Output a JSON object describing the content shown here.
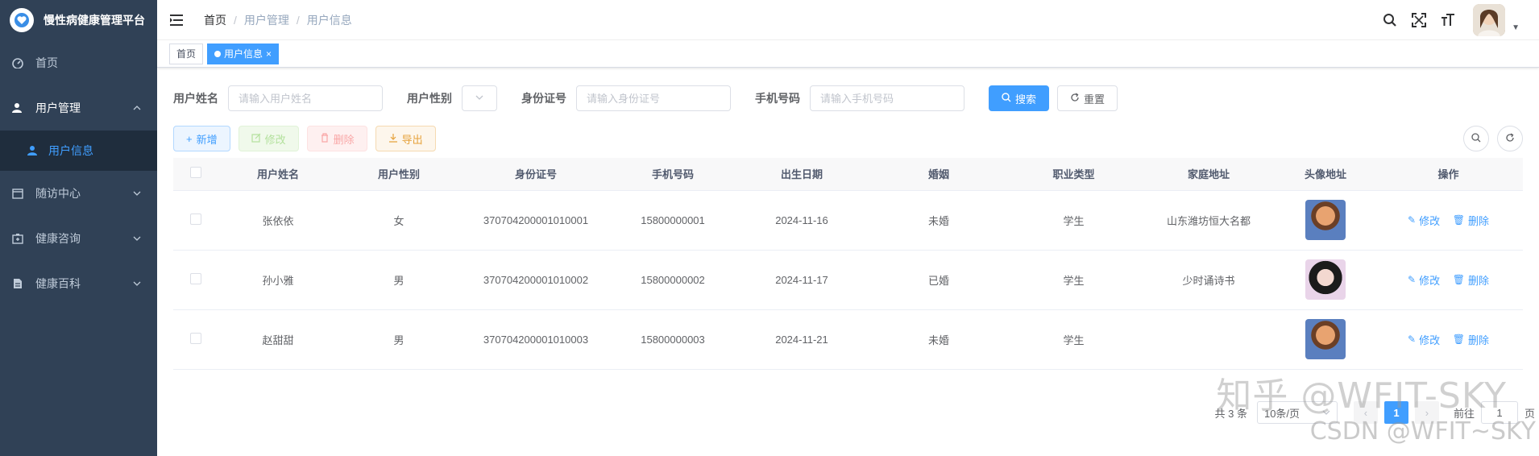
{
  "app": {
    "title": "慢性病健康管理平台"
  },
  "sidebar": {
    "items": [
      {
        "label": "首页",
        "icon": "dashboard-icon"
      },
      {
        "label": "用户管理",
        "icon": "user-icon",
        "open": true,
        "children": [
          {
            "label": "用户信息",
            "icon": "peoples-icon"
          }
        ]
      },
      {
        "label": "随访中心",
        "icon": "calendar-icon"
      },
      {
        "label": "健康咨询",
        "icon": "medkit-icon"
      },
      {
        "label": "健康百科",
        "icon": "document-icon"
      }
    ]
  },
  "breadcrumb": [
    "首页",
    "用户管理",
    "用户信息"
  ],
  "tags": [
    {
      "label": "首页"
    },
    {
      "label": "用户信息",
      "active": true
    }
  ],
  "search": {
    "name_label": "用户姓名",
    "name_placeholder": "请输入用户姓名",
    "gender_label": "用户性别",
    "id_label": "身份证号",
    "id_placeholder": "请输入身份证号",
    "phone_label": "手机号码",
    "phone_placeholder": "请输入手机号码",
    "search_btn": "搜索",
    "reset_btn": "重置"
  },
  "toolbar": {
    "add": "新增",
    "edit": "修改",
    "delete": "删除",
    "export": "导出"
  },
  "table": {
    "headers": [
      "用户姓名",
      "用户性别",
      "身份证号",
      "手机号码",
      "出生日期",
      "婚姻",
      "职业类型",
      "家庭地址",
      "头像地址",
      "操作"
    ],
    "rows": [
      {
        "name": "张依依",
        "gender": "女",
        "id": "370704200001010001",
        "phone": "15800000001",
        "birth": "2024-11-16",
        "marriage": "未婚",
        "job": "学生",
        "address": "山东潍坊恒大名都"
      },
      {
        "name": "孙小雅",
        "gender": "男",
        "id": "370704200001010002",
        "phone": "15800000002",
        "birth": "2024-11-17",
        "marriage": "已婚",
        "job": "学生",
        "address": "少时诵诗书"
      },
      {
        "name": "赵甜甜",
        "gender": "男",
        "id": "370704200001010003",
        "phone": "15800000003",
        "birth": "2024-11-21",
        "marriage": "未婚",
        "job": "学生",
        "address": ""
      }
    ],
    "op_edit": "修改",
    "op_delete": "删除"
  },
  "pagination": {
    "total": "共 3 条",
    "page_size": "10条/页",
    "current": "1",
    "goto_label": "前往",
    "goto_value": "1",
    "page_suffix": "页"
  },
  "watermark": {
    "line1": "知乎 @WFIT-SKY",
    "line2": "CSDN @WFIT~SKY"
  },
  "colors": {
    "sidebar_bg": "#304156",
    "primary": "#409eff"
  }
}
